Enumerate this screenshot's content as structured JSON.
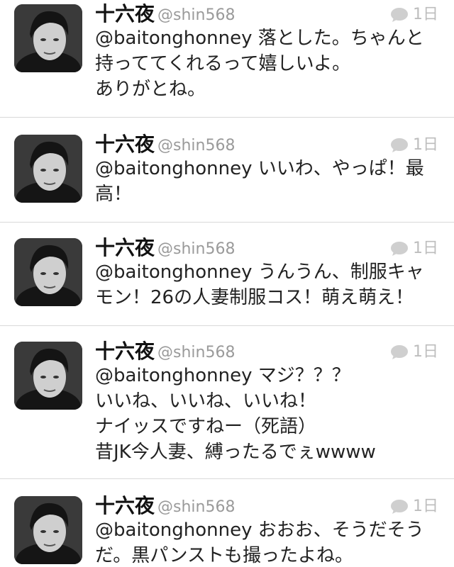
{
  "tweets": [
    {
      "name": "十六夜",
      "handle": "@shin568",
      "time": "1日",
      "mention": "@baitonghonney",
      "lines": [
        " 落とした。ちゃんと",
        "持っててくれるって嬉しいよ。",
        "ありがとね。"
      ]
    },
    {
      "name": "十六夜",
      "handle": "@shin568",
      "time": "1日",
      "mention": "@baitonghonney",
      "lines": [
        " いいわ、やっぱ！最",
        "高！"
      ]
    },
    {
      "name": "十六夜",
      "handle": "@shin568",
      "time": "1日",
      "mention": "@baitonghonney",
      "lines": [
        " うんうん、制服キャ",
        "モン！26の人妻制服コス！萌え萌え！"
      ]
    },
    {
      "name": "十六夜",
      "handle": "@shin568",
      "time": "1日",
      "mention": "@baitonghonney",
      "lines": [
        " マジ？？？",
        "いいね、いいね、いいね！",
        "ナイッスですねー（死語）",
        "昔JK今人妻、縛ったるでぇwwww"
      ]
    },
    {
      "name": "十六夜",
      "handle": "@shin568",
      "time": "1日",
      "mention": "@baitonghonney",
      "lines": [
        " おおお、そうだそう",
        "だ。黒パンストも撮ったよね。"
      ]
    }
  ]
}
